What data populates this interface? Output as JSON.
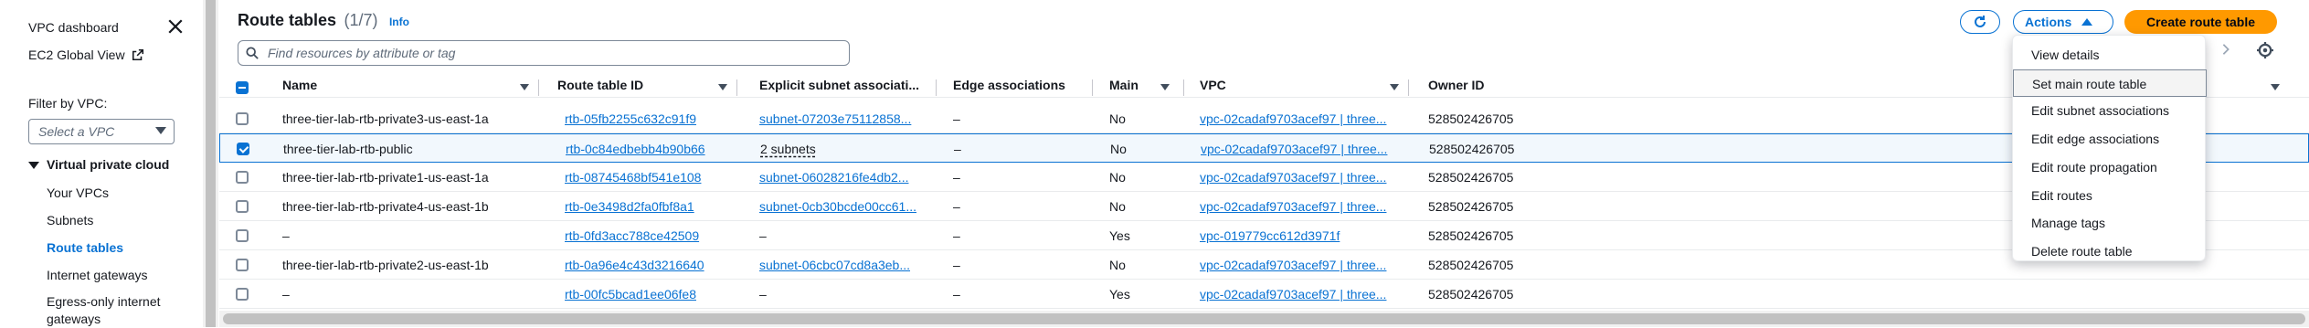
{
  "sidebar": {
    "dashboard": "VPC dashboard",
    "ec2_global_view": "EC2 Global View",
    "filter_label": "Filter by VPC:",
    "select_placeholder": "Select a VPC",
    "section": "Virtual private cloud",
    "items": [
      "Your VPCs",
      "Subnets",
      "Route tables",
      "Internet gateways",
      "Egress-only internet gateways"
    ]
  },
  "header": {
    "title": "Route tables",
    "count": "(1/7)",
    "info": "Info",
    "search_placeholder": "Find resources by attribute or tag",
    "actions_label": "Actions",
    "create_label": "Create route table"
  },
  "table": {
    "columns": [
      "Name",
      "Route table ID",
      "Explicit subnet associati...",
      "Edge associations",
      "Main",
      "VPC",
      "Owner ID"
    ],
    "rows": [
      {
        "checked": false,
        "name": "three-tier-lab-rtb-private3-us-east-1a",
        "id": "rtb-05fb2255c632c91f9",
        "subnet": "subnet-07203e75112858...",
        "edge": "–",
        "main": "No",
        "vpc": "vpc-02cadaf9703acef97 | three...",
        "owner": "528502426705"
      },
      {
        "checked": true,
        "name": "three-tier-lab-rtb-public",
        "id": "rtb-0c84edbebb4b90b66",
        "subnet": "2 subnets",
        "edge": "–",
        "main": "No",
        "vpc": "vpc-02cadaf9703acef97 | three...",
        "owner": "528502426705"
      },
      {
        "checked": false,
        "name": "three-tier-lab-rtb-private1-us-east-1a",
        "id": "rtb-08745468bf541e108",
        "subnet": "subnet-06028216fe4db2...",
        "edge": "–",
        "main": "No",
        "vpc": "vpc-02cadaf9703acef97 | three...",
        "owner": "528502426705"
      },
      {
        "checked": false,
        "name": "three-tier-lab-rtb-private4-us-east-1b",
        "id": "rtb-0e3498d2fa0fbf8a1",
        "subnet": "subnet-0cb30bcde00cc61...",
        "edge": "–",
        "main": "No",
        "vpc": "vpc-02cadaf9703acef97 | three...",
        "owner": "528502426705"
      },
      {
        "checked": false,
        "name": "–",
        "id": "rtb-0fd3acc788ce42509",
        "subnet": "–",
        "edge": "–",
        "main": "Yes",
        "vpc": "vpc-019779cc612d3971f",
        "owner": "528502426705"
      },
      {
        "checked": false,
        "name": "three-tier-lab-rtb-private2-us-east-1b",
        "id": "rtb-0a96e4c43d3216640",
        "subnet": "subnet-06cbc07cd8a3eb...",
        "edge": "–",
        "main": "No",
        "vpc": "vpc-02cadaf9703acef97 | three...",
        "owner": "528502426705"
      },
      {
        "checked": false,
        "name": "–",
        "id": "rtb-00fc5bcad1ee06fe8",
        "subnet": "–",
        "edge": "–",
        "main": "Yes",
        "vpc": "vpc-02cadaf9703acef97 | three...",
        "owner": "528502426705"
      }
    ]
  },
  "actions_menu": {
    "items": [
      "View details",
      "Set main route table",
      "Edit subnet associations",
      "Edit edge associations",
      "Edit route propagation",
      "Edit routes",
      "Manage tags",
      "Delete route table"
    ],
    "hovered": "Set main route table"
  },
  "colors": {
    "accent": "#0972d3",
    "primary_button": "#ff9900",
    "selected_row_bg": "#f2f8fd"
  }
}
